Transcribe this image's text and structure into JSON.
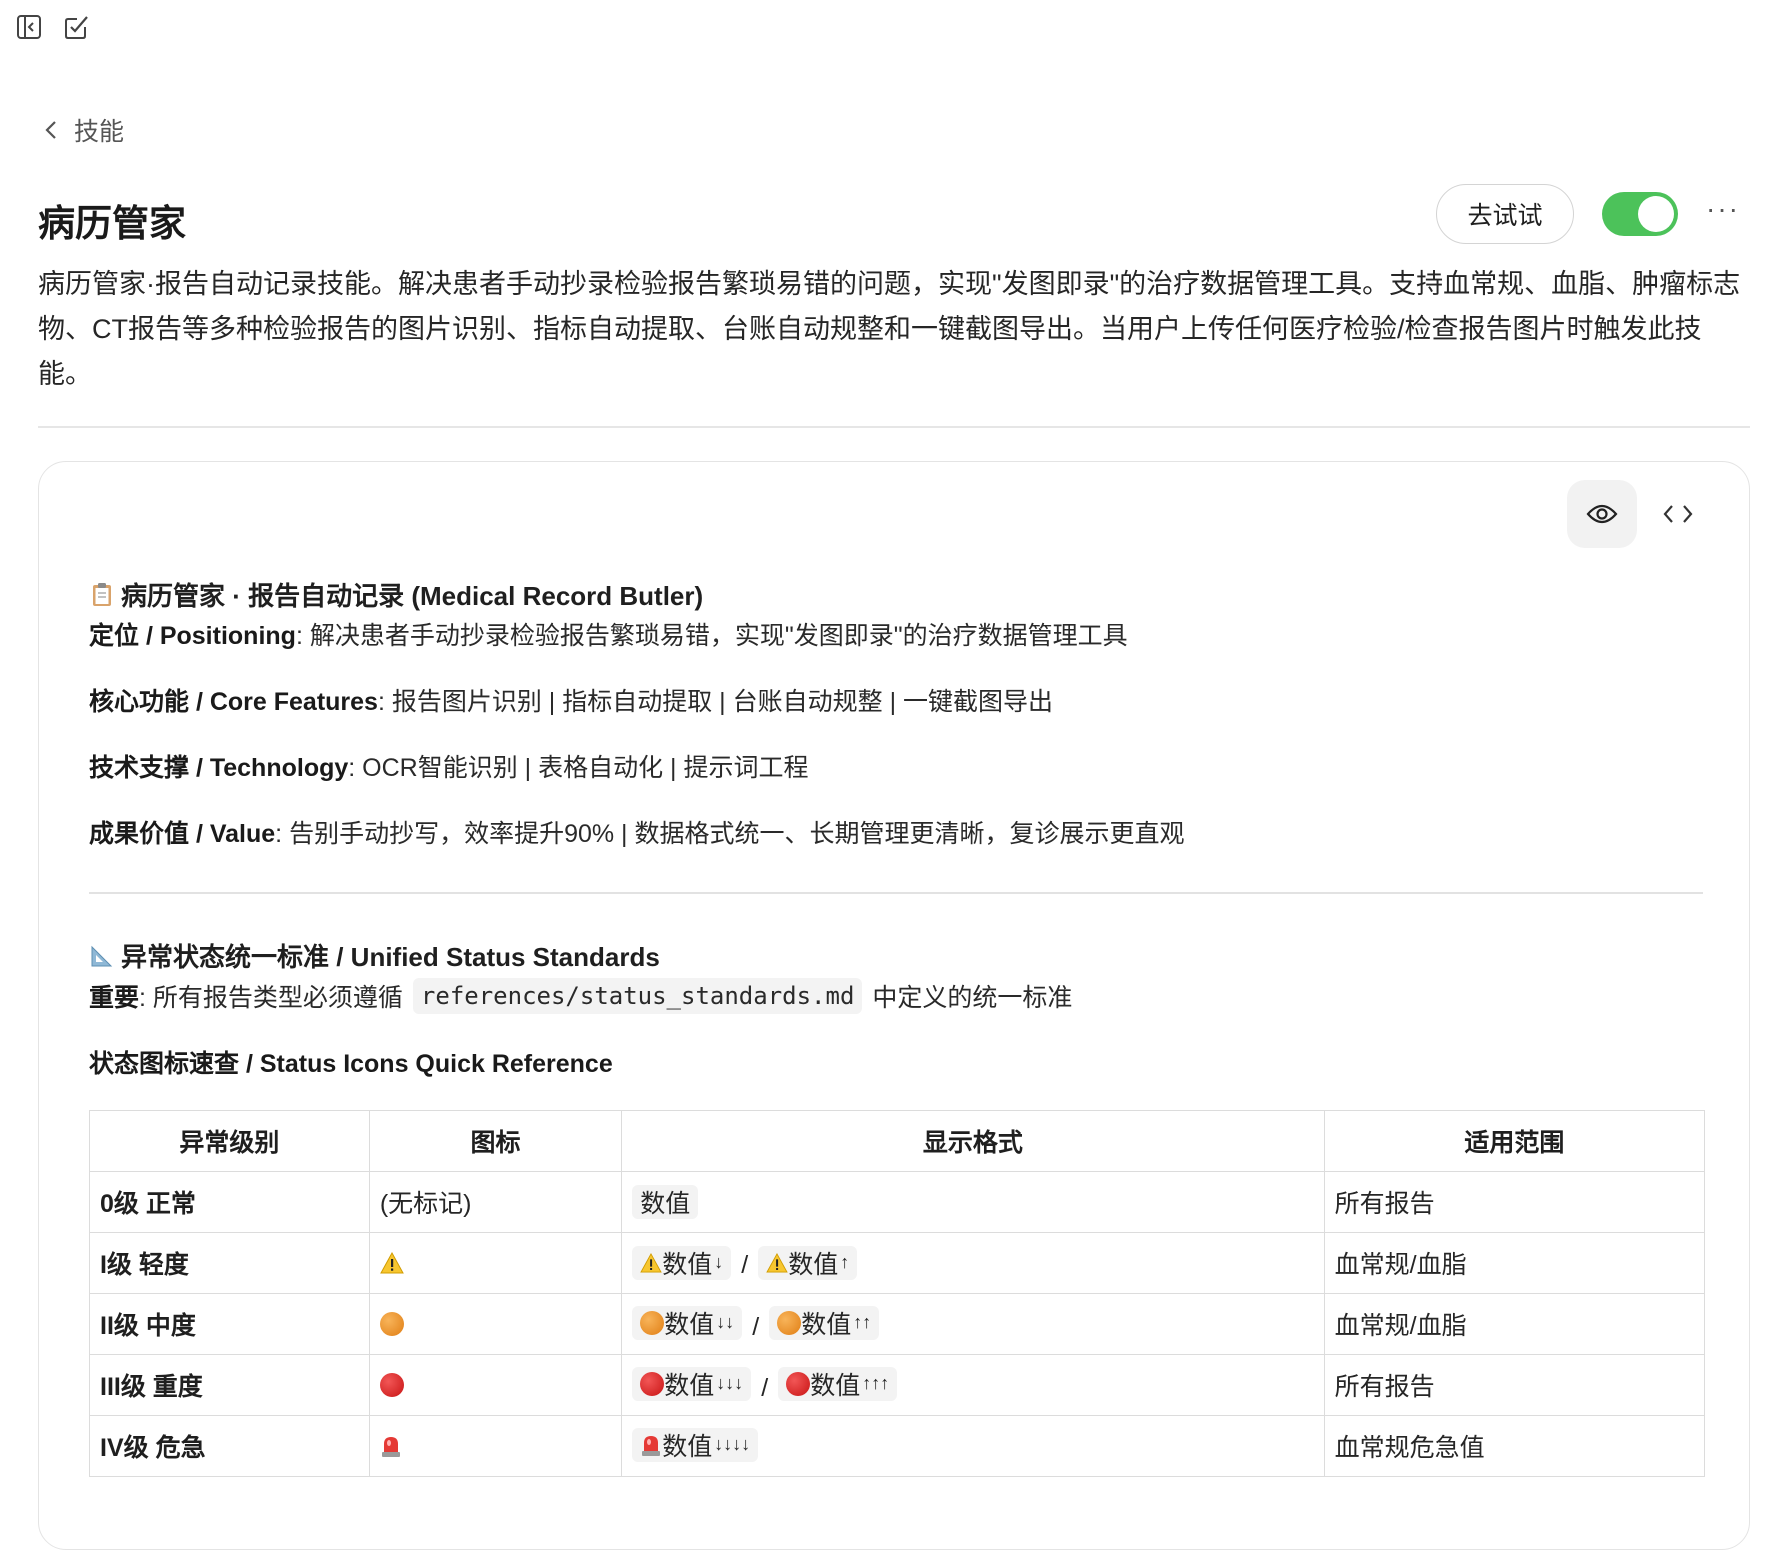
{
  "topbar": {
    "icons": [
      "sidebar-toggle-icon",
      "new-task-icon"
    ]
  },
  "nav": {
    "back_label": "技能"
  },
  "skill": {
    "title": "病历管家",
    "try_label": "去试试",
    "enabled": true,
    "description": "病历管家·报告自动记录技能。解决患者手动抄录检验报告繁琐易错的问题，实现\"发图即录\"的治疗数据管理工具。支持血常规、血脂、肿瘤标志物、CT报告等多种检验报告的图片识别、指标自动提取、台账自动规整和一键截图导出。当用户上传任何医疗检验/检查报告图片时触发此技能。"
  },
  "doc": {
    "heading1": "病历管家 · 报告自动记录 (Medical Record Butler)",
    "positioning_label": "定位 / Positioning",
    "positioning_text": ": 解决患者手动抄录检验报告繁琐易错，实现\"发图即录\"的治疗数据管理工具",
    "features_label": "核心功能 / Core Features",
    "features_text": ": 报告图片识别 | 指标自动提取 | 台账自动规整 | 一键截图导出",
    "tech_label": "技术支撑 / Technology",
    "tech_text": ": OCR智能识别 | 表格自动化 | 提示词工程",
    "value_label": "成果价值 / Value",
    "value_text": ": 告别手动抄写，效率提升90% | 数据格式统一、长期管理更清晰，复诊展示更直观",
    "heading2": "异常状态统一标准 / Unified Status Standards",
    "important_label": "重要",
    "important_pre": ": 所有报告类型必须遵循",
    "important_code": "references/status_standards.md",
    "important_post": "中定义的统一标准",
    "table_title": "状态图标速查 / Status Icons Quick Reference",
    "table": {
      "headers": [
        "异常级别",
        "图标",
        "显示格式",
        "适用范围"
      ],
      "rows": [
        {
          "level": "0级 正常",
          "icon_text": "(无标记)",
          "value": "数值",
          "scope": "所有报告"
        },
        {
          "level": "I级 轻度",
          "value": "数值",
          "down": "↓",
          "up": "↑",
          "scope": "血常规/血脂"
        },
        {
          "level": "II级 中度",
          "value": "数值",
          "down": "↓↓",
          "up": "↑↑",
          "scope": "血常规/血脂"
        },
        {
          "level": "III级 重度",
          "value": "数值",
          "down": "↓↓↓",
          "up": "↑↑↑",
          "scope": "所有报告"
        },
        {
          "level": "IV级 危急",
          "value": "数值",
          "down": "↓↓↓↓",
          "scope": "血常规危急值"
        }
      ]
    }
  }
}
